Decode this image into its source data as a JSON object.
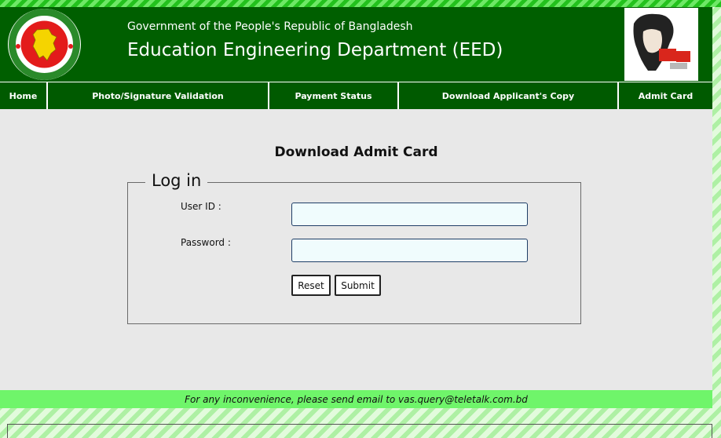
{
  "header": {
    "gov_line": "Government of the People's Republic of Bangladesh",
    "dept_line": "Education Engineering Department (EED)",
    "emblem_icon": "bangladesh-emblem-icon",
    "portrait_icon": "mujib-100-logo-icon"
  },
  "nav": {
    "items": [
      {
        "label": "Home"
      },
      {
        "label": "Photo/Signature Validation"
      },
      {
        "label": "Payment Status"
      },
      {
        "label": "Download Applicant's Copy"
      },
      {
        "label": "Admit Card"
      }
    ]
  },
  "main": {
    "title": "Download Admit Card",
    "legend": "Log in",
    "user_id_label": "User ID :",
    "password_label": "Password :",
    "user_id_value": "",
    "password_value": "",
    "reset_label": "Reset",
    "submit_label": "Submit"
  },
  "footer": {
    "text": "For any inconvenience, please send email to vas.query@teletalk.com.bd"
  },
  "colors": {
    "header_bg": "#005f00",
    "nav_bg": "#005a00",
    "content_bg": "#e8e8e8",
    "footer_bg": "#6ff56a",
    "input_border": "#1f3d66"
  }
}
